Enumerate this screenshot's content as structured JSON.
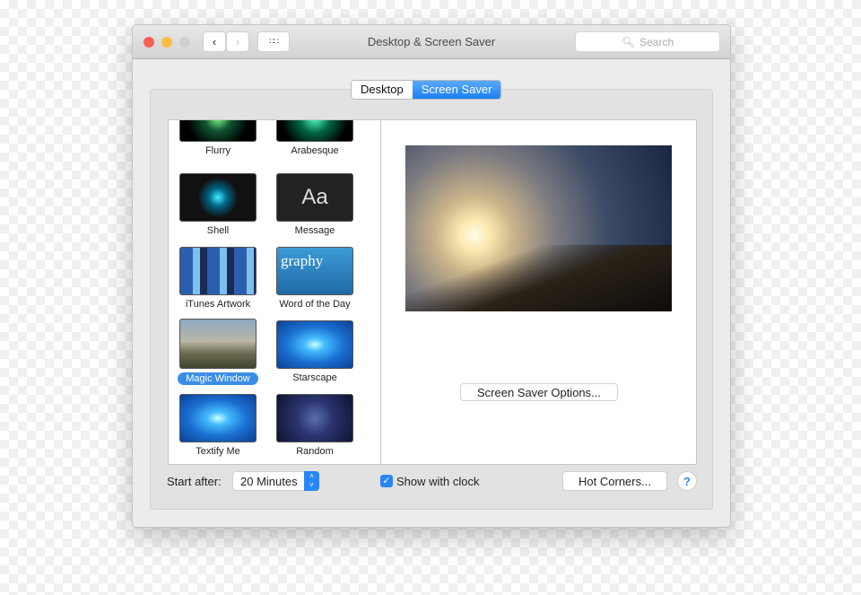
{
  "window": {
    "title": "Desktop & Screen Saver",
    "search_placeholder": "Search"
  },
  "tabs": [
    {
      "label": "Desktop",
      "selected": false
    },
    {
      "label": "Screen Saver",
      "selected": true
    }
  ],
  "savers": [
    {
      "label": "Flurry"
    },
    {
      "label": "Arabesque"
    },
    {
      "label": "Shell"
    },
    {
      "label": "Message"
    },
    {
      "label": "iTunes Artwork"
    },
    {
      "label": "Word of the Day"
    },
    {
      "label": "Magic Window",
      "selected": true
    },
    {
      "label": "Starscape"
    },
    {
      "label": "Textify Me"
    },
    {
      "label": "Random"
    }
  ],
  "thumb_text": {
    "message": "Aa",
    "word": "graphy"
  },
  "options_button": "Screen Saver Options...",
  "start_after_label": "Start after:",
  "start_after_value": "20 Minutes",
  "show_clock_label": "Show with clock",
  "show_clock_checked": true,
  "hot_corners": "Hot Corners...",
  "help": "?",
  "accent": "#3a8ee6"
}
